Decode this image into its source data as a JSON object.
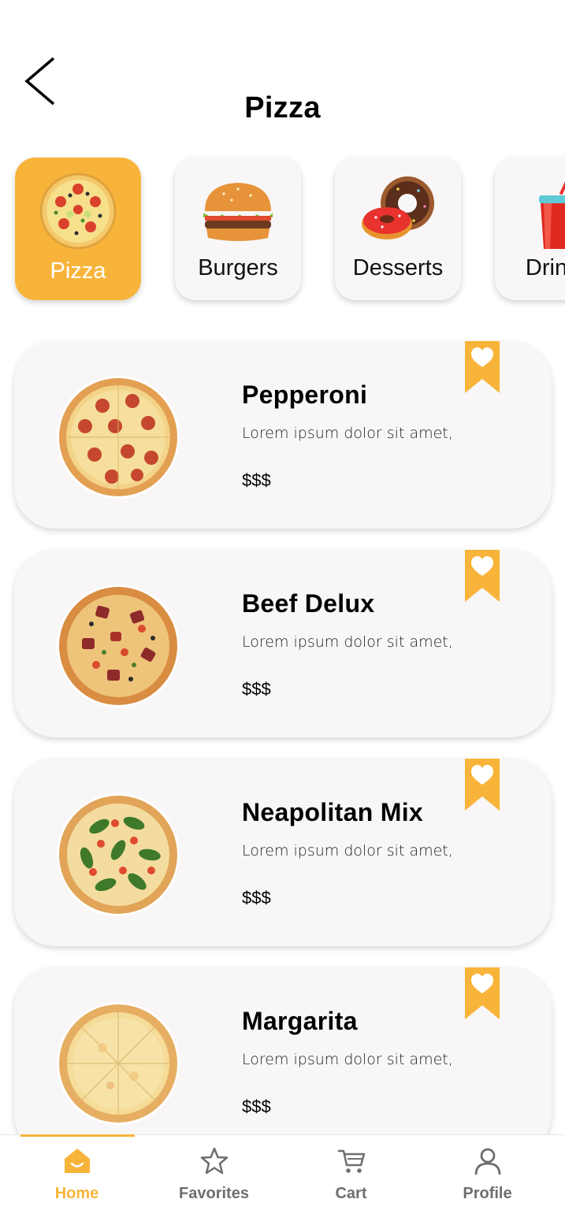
{
  "header": {
    "title": "Pizza"
  },
  "categories": [
    {
      "label": "Pizza",
      "active": true
    },
    {
      "label": "Burgers",
      "active": false
    },
    {
      "label": "Desserts",
      "active": false
    },
    {
      "label": "Drinks",
      "active": false
    }
  ],
  "items": [
    {
      "name": "Pepperoni",
      "description": "Lorem ipsum dolor sit amet,",
      "price": "$$$"
    },
    {
      "name": "Beef Delux",
      "description": "Lorem ipsum dolor sit amet,",
      "price": "$$$"
    },
    {
      "name": "Neapolitan Mix",
      "description": "Lorem ipsum dolor sit amet,",
      "price": "$$$"
    },
    {
      "name": "Margarita",
      "description": "Lorem ipsum dolor sit amet,",
      "price": "$$$"
    }
  ],
  "nav": {
    "home": "Home",
    "favorites": "Favorites",
    "cart": "Cart",
    "profile": "Profile"
  },
  "colors": {
    "accent": "#f8b43a",
    "card_background": "#f8f6f7",
    "inactive_nav": "#6e6e6e"
  }
}
